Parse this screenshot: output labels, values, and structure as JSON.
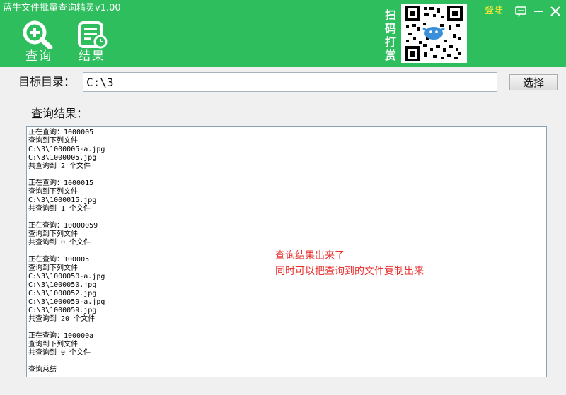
{
  "window": {
    "title": "蓝牛文件批量查询精灵v1.00",
    "login_label": "登陆",
    "controls": [
      "feedback-icon",
      "minimize-icon",
      "close-icon"
    ]
  },
  "toolbar": {
    "query_label": "查询",
    "results_label": "结果",
    "scan_text": "扫码打赏"
  },
  "form": {
    "dir_label": "目标目录：",
    "dir_value": "C:\\3",
    "choose_label": "选择",
    "results_heading": "查询结果："
  },
  "results": [
    "正在查询：1000005",
    "查询到下列文件",
    "C:\\3\\1000005-a.jpg",
    "C:\\3\\1000005.jpg",
    "共查询到 2 个文件",
    "",
    "正在查询：1000015",
    "查询到下列文件",
    "C:\\3\\1000015.jpg",
    "共查询到 1 个文件",
    "",
    "正在查询：10000059",
    "查询到下列文件",
    "共查询到 0 个文件",
    "",
    "正在查询：100005",
    "查询到下列文件",
    "C:\\3\\1000050-a.jpg",
    "C:\\3\\1000050.jpg",
    "C:\\3\\1000052.jpg",
    "C:\\3\\1000059-a.jpg",
    "C:\\3\\1000059.jpg",
    "共查询到 20 个文件",
    "",
    "正在查询：100000a",
    "查询到下列文件",
    "共查询到 0 个文件",
    "",
    "查询总结"
  ],
  "annotation": {
    "line1": "查询结果出来了",
    "line2": "同时可以把查询到的文件复制出来"
  },
  "colors": {
    "header": "#2fbe5e",
    "login": "#ffee33",
    "annotation": "#e8312f"
  }
}
